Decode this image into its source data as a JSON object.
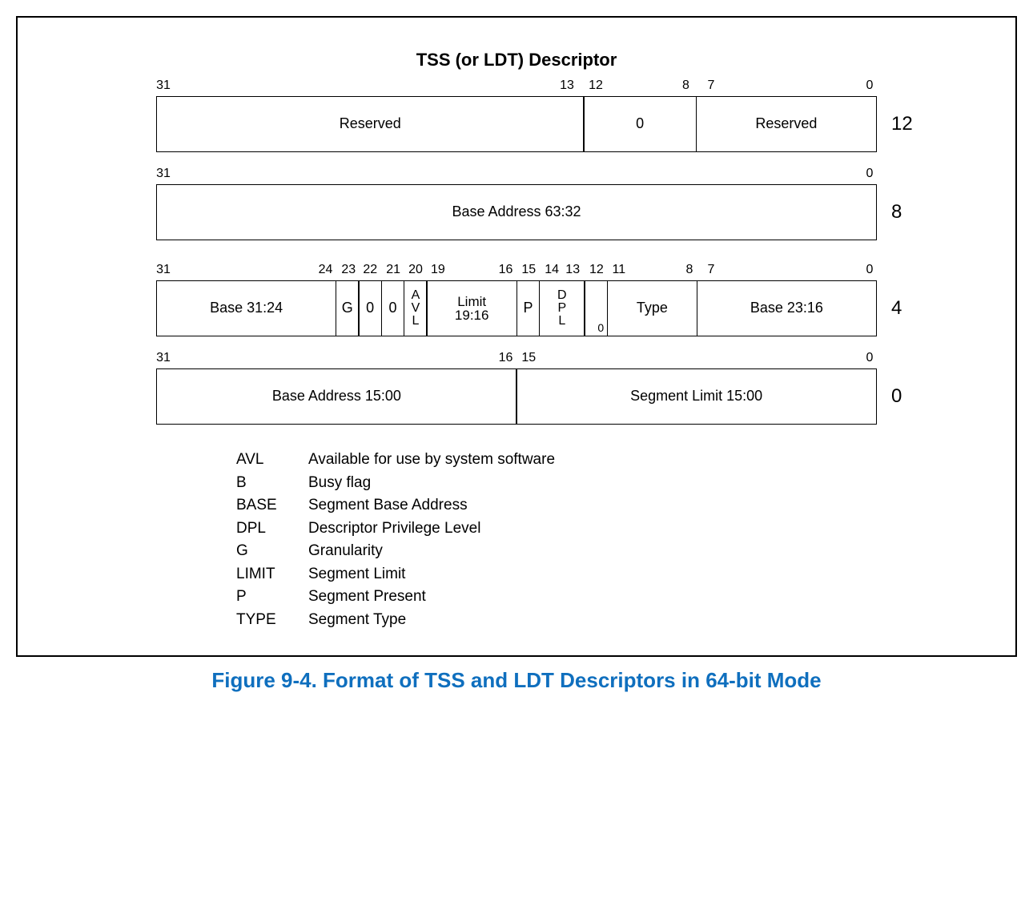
{
  "title": "TSS (or LDT) Descriptor",
  "caption": "Figure 9-4.  Format of TSS and LDT Descriptors in 64-bit Mode",
  "dword12": {
    "offset": "12",
    "bits": {
      "b31": "31",
      "b13": "13",
      "b12": "12",
      "b8": "8",
      "b7": "7",
      "b0": "0"
    },
    "reserved_hi": "Reserved",
    "zero": "0",
    "reserved_lo": "Reserved"
  },
  "dword8": {
    "offset": "8",
    "bits": {
      "b31": "31",
      "b0": "0"
    },
    "base_hi": "Base Address 63:32"
  },
  "dword4": {
    "offset": "4",
    "bits": {
      "b31": "31",
      "b24": "24",
      "b23": "23",
      "b22": "22",
      "b21": "21",
      "b20": "20",
      "b19": "19",
      "b16": "16",
      "b15": "15",
      "b14": "14",
      "b13": "13",
      "b12": "12",
      "b11": "11",
      "b8": "8",
      "b7": "7",
      "b0": "0"
    },
    "base3124": "Base 31:24",
    "g": "G",
    "z1": "0",
    "z2": "0",
    "avl_a": "A",
    "avl_v": "V",
    "avl_l": "L",
    "limit_top": "Limit",
    "limit_bot": "19:16",
    "p": "P",
    "dpl_d": "D",
    "dpl_p": "P",
    "dpl_l": "L",
    "zero12": "0",
    "type": "Type",
    "base2316": "Base 23:16"
  },
  "dword0": {
    "offset": "0",
    "bits": {
      "b31": "31",
      "b16": "16",
      "b15": "15",
      "b0": "0"
    },
    "base_lo": "Base Address 15:00",
    "seg_limit": "Segment Limit 15:00"
  },
  "legend": [
    {
      "key": "AVL",
      "desc": "Available for use by system software"
    },
    {
      "key": "B",
      "desc": "Busy flag"
    },
    {
      "key": "BASE",
      "desc": "Segment Base Address"
    },
    {
      "key": "DPL",
      "desc": "Descriptor Privilege Level"
    },
    {
      "key": "G",
      "desc": "Granularity"
    },
    {
      "key": "LIMIT",
      "desc": "Segment Limit"
    },
    {
      "key": "P",
      "desc": "Segment Present"
    },
    {
      "key": "TYPE",
      "desc": "Segment Type"
    }
  ]
}
